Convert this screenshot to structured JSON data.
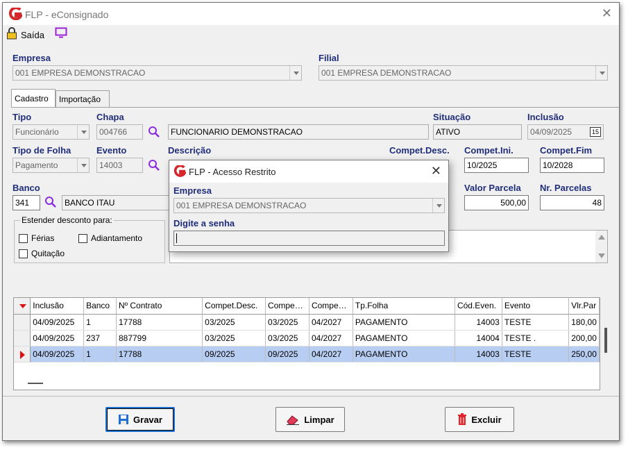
{
  "window": {
    "title": "FLP - eConsignado",
    "close": "✕"
  },
  "toolbar": {
    "saida": "Saída"
  },
  "empresa": {
    "label": "Empresa",
    "value": "001 EMPRESA DEMONSTRACAO"
  },
  "filial": {
    "label": "Filial",
    "value": "001 EMPRESA DEMONSTRACAO"
  },
  "tabs": [
    {
      "label": "Cadastro"
    },
    {
      "label": "Importação"
    }
  ],
  "form": {
    "tipo": {
      "label": "Tipo",
      "value": "Funcionário"
    },
    "chapa": {
      "label": "Chapa",
      "value": "004766"
    },
    "nome": {
      "value": "FUNCIONARIO DEMONSTRACAO"
    },
    "situacao": {
      "label": "Situação",
      "value": "ATIVO"
    },
    "inclusao": {
      "label": "Inclusão",
      "value": "04/09/2025",
      "cal": "15"
    },
    "tipo_folha": {
      "label": "Tipo de Folha",
      "value": "Pagamento"
    },
    "evento": {
      "label": "Evento",
      "value": "14003"
    },
    "descricao": {
      "label": "Descrição"
    },
    "compet_desc": {
      "label": "Compet.Desc."
    },
    "compet_ini": {
      "label": "Compet.Ini.",
      "value": "10/2025"
    },
    "compet_fim": {
      "label": "Compet.Fim",
      "value": "10/2028"
    },
    "banco": {
      "label": "Banco",
      "code": "341",
      "name": "BANCO ITAU"
    },
    "valor_parcela": {
      "label": "Valor Parcela",
      "value": "500,00"
    },
    "nr_parcelas": {
      "label": "Nr. Parcelas",
      "value": "48"
    },
    "estender": {
      "title": "Estender desconto para:",
      "ferias": "Férias",
      "adiantamento": "Adiantamento",
      "quitacao": "Quitação"
    }
  },
  "grid": {
    "columns": [
      "Inclusão",
      "Banco",
      "Nº Contrato",
      "Compet.Desc.",
      "Compe…",
      "Compe…",
      "Tp.Folha",
      "Cód.Even.",
      "Evento",
      "Vlr.Par"
    ],
    "rows": [
      [
        "04/09/2025",
        "1",
        "17788",
        "03/2025",
        "03/2025",
        "04/2027",
        "PAGAMENTO",
        "14003",
        "TESTE",
        "180,00"
      ],
      [
        "04/09/2025",
        "237",
        "887799",
        "03/2025",
        "03/2025",
        "04/2027",
        "PAGAMENTO",
        "14004",
        "TESTE .",
        "200,00"
      ],
      [
        "04/09/2025",
        "1",
        "17788",
        "09/2025",
        "09/2025",
        "04/2027",
        "PAGAMENTO",
        "14003",
        "TESTE",
        "250,00"
      ]
    ]
  },
  "buttons": {
    "gravar": "Gravar",
    "limpar": "Limpar",
    "excluir": "Excluir"
  },
  "dialog": {
    "title": "FLP - Acesso Restrito",
    "close": "✕",
    "empresa_label": "Empresa",
    "empresa_value": "001 EMPRESA DEMONSTRACAO",
    "senha_label": "Digite a senha",
    "senha_value": ""
  }
}
